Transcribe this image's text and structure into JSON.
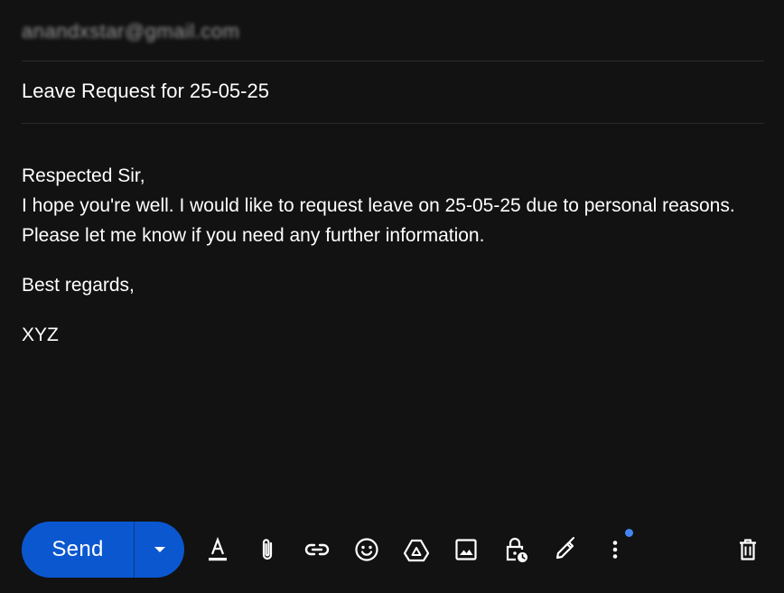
{
  "to": {
    "value": "anandxstar@gmail.com",
    "blurred": true
  },
  "subject": {
    "value": "Leave Request for 25-05-25"
  },
  "body": {
    "greeting": "Respected Sir,",
    "paragraph": "I hope you're well. I would like to request leave on 25-05-25 due to personal reasons. Please let me know if you need any further information.",
    "closing": "Best regards,",
    "signature": "XYZ"
  },
  "toolbar": {
    "send_label": "Send",
    "icons": [
      "formatting-options-icon",
      "attach-file-icon",
      "insert-link-icon",
      "insert-emoji-icon",
      "insert-drive-icon",
      "insert-photo-icon",
      "confidential-mode-icon",
      "insert-signature-icon",
      "more-options-icon",
      "discard-draft-icon"
    ],
    "notification_dot": true
  },
  "colors": {
    "background": "#121212",
    "send_button": "#0b57d0",
    "text": "#ffffff",
    "divider": "#2a2a2a",
    "notification_dot": "#4285f4"
  }
}
